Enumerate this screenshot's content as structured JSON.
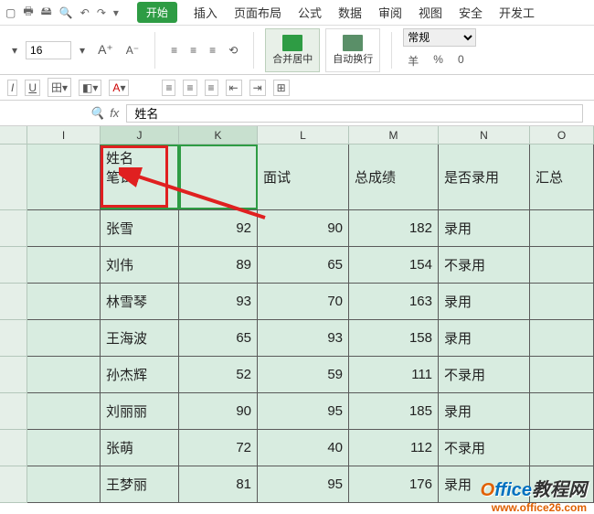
{
  "qat": {
    "icons": [
      "blank",
      "save",
      "print",
      "preview",
      "undo",
      "redo"
    ]
  },
  "tabs": {
    "active": "开始",
    "items": [
      "插入",
      "页面布局",
      "公式",
      "数据",
      "审阅",
      "视图",
      "安全",
      "开发工"
    ]
  },
  "ribbon": {
    "font_size": "16",
    "merge_center": "合并居中",
    "auto_wrap": "自动换行",
    "number_format": "常规",
    "currency": "羊",
    "percent": "%"
  },
  "formula_bar": {
    "fx": "fx",
    "value": "姓名"
  },
  "columns": [
    "I",
    "J",
    "K",
    "L",
    "M",
    "N",
    "O"
  ],
  "header_multiline": "姓名\n笔试",
  "headers": {
    "L": "面试",
    "M": "总成绩",
    "N": "是否录用",
    "O": "汇总"
  },
  "rows": [
    {
      "name": "张雪",
      "k": 92,
      "l": 90,
      "m": 182,
      "n": "录用"
    },
    {
      "name": "刘伟",
      "k": 89,
      "l": 65,
      "m": 154,
      "n": "不录用"
    },
    {
      "name": "林雪琴",
      "k": 93,
      "l": 70,
      "m": 163,
      "n": "录用"
    },
    {
      "name": "王海波",
      "k": 65,
      "l": 93,
      "m": 158,
      "n": "录用"
    },
    {
      "name": "孙杰辉",
      "k": 52,
      "l": 59,
      "m": 111,
      "n": "不录用"
    },
    {
      "name": "刘丽丽",
      "k": 90,
      "l": 95,
      "m": 185,
      "n": "录用"
    },
    {
      "name": "张萌",
      "k": 72,
      "l": 40,
      "m": 112,
      "n": "不录用"
    },
    {
      "name": "王梦丽",
      "k": 81,
      "l": 95,
      "m": 176,
      "n": "录用"
    }
  ],
  "watermark": {
    "brand": "Office教程网",
    "url": "www.office26.com"
  }
}
